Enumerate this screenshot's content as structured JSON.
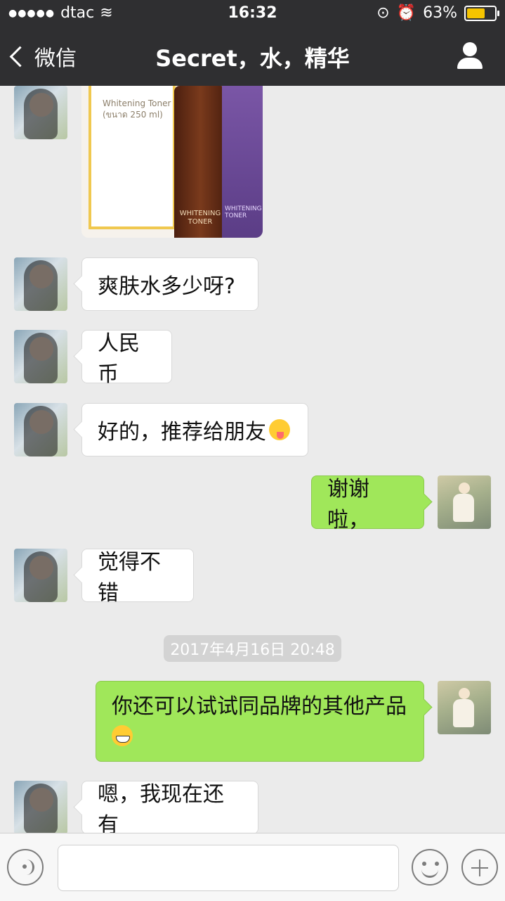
{
  "status_bar": {
    "signal": "●●●●●",
    "carrier": "dtac",
    "time": "16:32",
    "battery_pct": "63%"
  },
  "header": {
    "back_label": "微信",
    "title": "Secret，水，精华"
  },
  "product_image": {
    "box_text": "Whitening Toner",
    "box_sub": "(ขนาด 250 ml)",
    "bottle_text": "WHITENING TONER",
    "purple_text": "WHITENING TONER"
  },
  "messages": [
    {
      "side": "left",
      "text": "爽肤水多少呀?"
    },
    {
      "side": "left",
      "text": "人民币"
    },
    {
      "side": "left",
      "text": "好的，推荐给朋友",
      "emoji": "tongue-emoji"
    },
    {
      "side": "right",
      "text": "谢谢啦，"
    },
    {
      "side": "left",
      "text": "觉得不错"
    },
    {
      "side": "right",
      "text": "你还可以试试同品牌的其他产品",
      "emoji": "grin-emoji"
    },
    {
      "side": "left",
      "text": "嗯，我现在还有"
    }
  ],
  "timestamp": "2017年4月16日 20:48",
  "bottom_bar": {
    "input_placeholder": ""
  }
}
